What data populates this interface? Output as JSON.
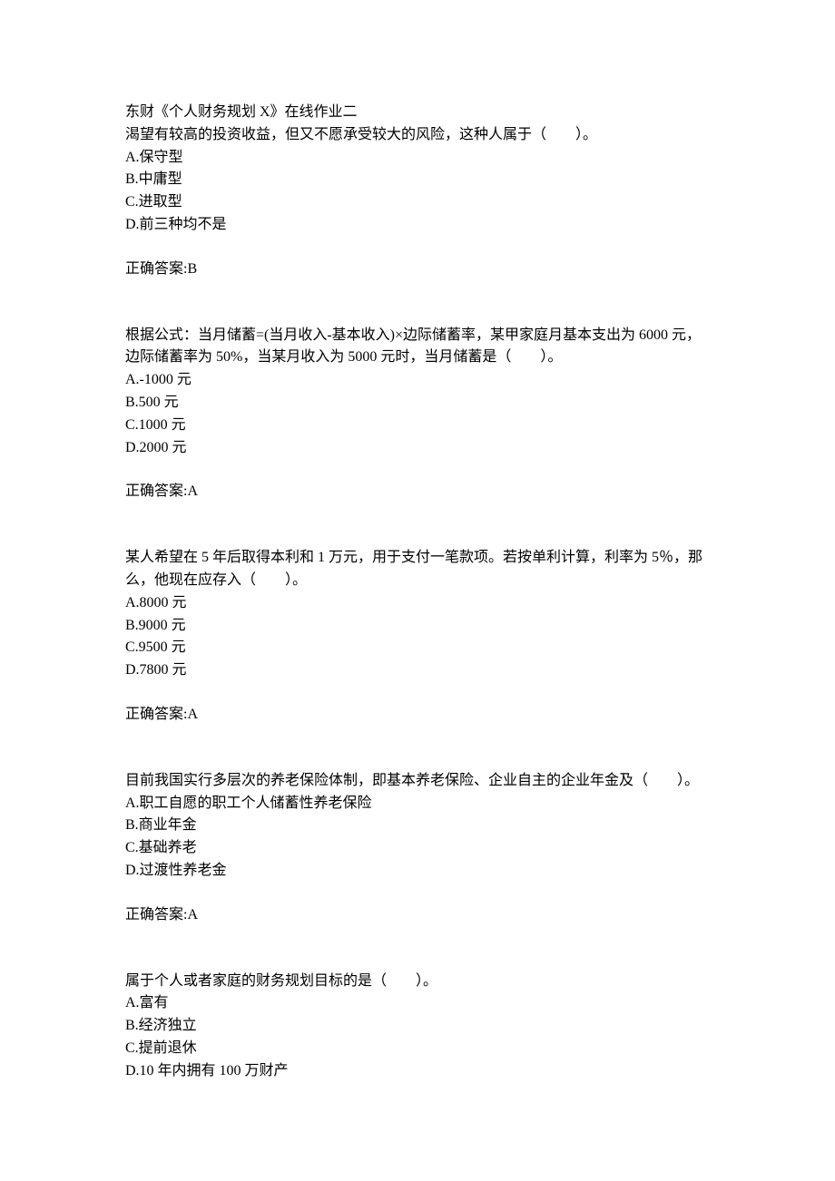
{
  "title": "东财《个人财务规划 X》在线作业二",
  "answer_prefix": "正确答案:",
  "questions": [
    {
      "text": "渴望有较高的投资收益，但又不愿承受较大的风险，这种人属于（　　）。",
      "options": {
        "A": "A.保守型",
        "B": "B.中庸型",
        "C": "C.进取型",
        "D": "D.前三种均不是"
      },
      "answer": "B"
    },
    {
      "text": "根据公式：当月储蓄=(当月收入-基本收入)×边际储蓄率，某甲家庭月基本支出为 6000 元，边际储蓄率为 50%，当某月收入为 5000 元时，当月储蓄是（　　）。",
      "options": {
        "A": "A.-1000 元",
        "B": "B.500 元",
        "C": "C.1000 元",
        "D": "D.2000 元"
      },
      "answer": "A"
    },
    {
      "text": "某人希望在 5 年后取得本利和 1 万元，用于支付一笔款项。若按单利计算，利率为 5％，那么，他现在应存入（　　）。",
      "options": {
        "A": "A.8000 元",
        "B": "B.9000 元",
        "C": "C.9500 元",
        "D": "D.7800 元"
      },
      "answer": "A"
    },
    {
      "text": "目前我国实行多层次的养老保险体制，即基本养老保险、企业自主的企业年金及（　　）。",
      "options": {
        "A": "A.职工自愿的职工个人储蓄性养老保险",
        "B": "B.商业年金",
        "C": "C.基础养老",
        "D": "D.过渡性养老金"
      },
      "answer": "A"
    },
    {
      "text": "属于个人或者家庭的财务规划目标的是（　　）。",
      "options": {
        "A": "A.富有",
        "B": "B.经济独立",
        "C": "C.提前退休",
        "D": "D.10 年内拥有 100 万财产"
      },
      "answer": ""
    }
  ]
}
